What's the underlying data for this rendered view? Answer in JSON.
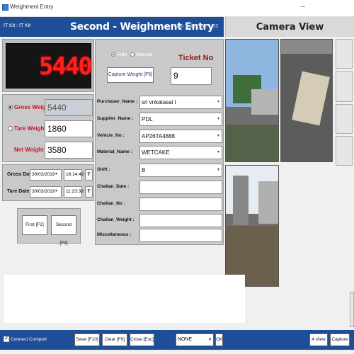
{
  "window": {
    "title": "Weighment Entry"
  },
  "header": {
    "it_kit": "IT Kit : IT Kit",
    "title": "Second - Weighment Entry",
    "last_ticket": "Last Ticket No : - 33"
  },
  "camera_view_title": "Camera View",
  "display": {
    "value": "5440",
    "color": "#ff2020"
  },
  "weights": {
    "gross": {
      "label": "Gross Weight :",
      "value": "5440",
      "selected": true
    },
    "tare": {
      "label": "Tare Weight :",
      "value": "1860",
      "selected": false
    },
    "net": {
      "label": "Net Weight :",
      "value": "3580"
    }
  },
  "dates": {
    "gross": {
      "label": "Gross Date",
      "date": "30/03/2019",
      "time": "16:14:49",
      "btn": "T"
    },
    "tare": {
      "label": "Tare Date",
      "date": "30/03/2019",
      "time": "11:23:38",
      "btn": "T"
    }
  },
  "actions": {
    "first": "First [F2]",
    "second": "Second [F3]"
  },
  "mode": {
    "auto": "Auto",
    "manual": "Manual",
    "selected": "auto"
  },
  "ticket": {
    "label": "Ticket No",
    "value": "9"
  },
  "capture_button": "Capture Weight [F5]",
  "fields": [
    {
      "label": "Purchaser_Name :",
      "value": "sri vnkatasai t",
      "dropdown": true
    },
    {
      "label": "Supplier_Name :",
      "value": "PDL",
      "dropdown": true
    },
    {
      "label": "Vehicle_No :",
      "value": "AP26TA4888",
      "dropdown": true
    },
    {
      "label": "Material_Name :",
      "value": "WETCAKE",
      "dropdown": true
    },
    {
      "label": "Shift :",
      "value": "B",
      "dropdown": true
    },
    {
      "label": "Challan_Date :",
      "value": "",
      "dropdown": false
    },
    {
      "label": "Challan_No :",
      "value": "",
      "dropdown": false
    },
    {
      "label": "Challan_Weight :",
      "value": "",
      "dropdown": false
    },
    {
      "label": "Miscellaneous :",
      "value": "",
      "dropdown": false
    }
  ],
  "bottom": {
    "connect_comport": "Connect Comport",
    "save": "Save [F10]",
    "clear": "Clear [F6]",
    "close": "Close [Esc]",
    "port_select": "NONE",
    "ok": "OK",
    "four_view": "4 View",
    "capture": "Capture"
  },
  "colors": {
    "header_bg": "#1d4e97",
    "label_red": "#c8102e",
    "ticket_label": "#8b1a1a"
  }
}
